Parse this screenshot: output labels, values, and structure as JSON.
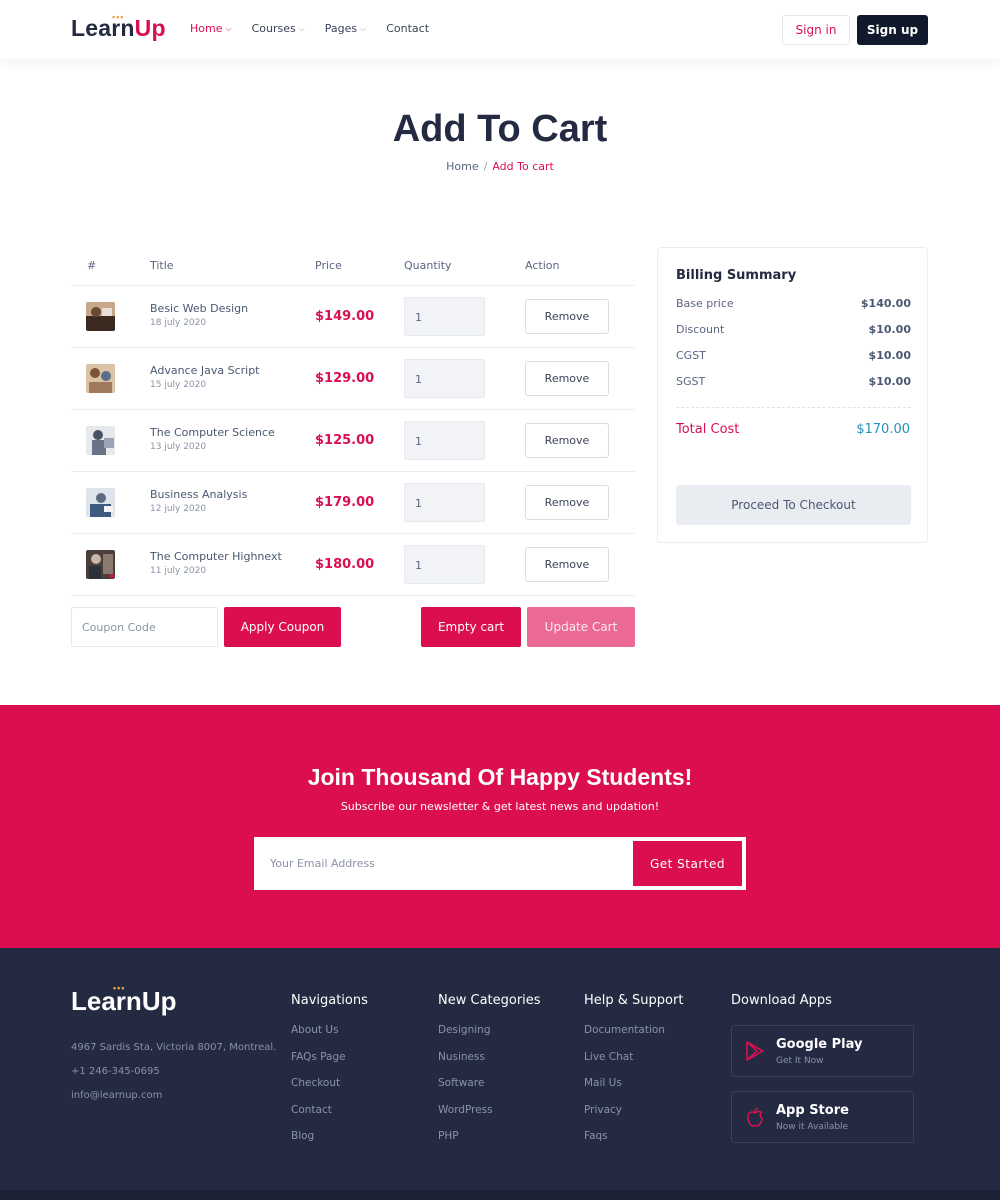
{
  "header": {
    "logo_learn": "Learn",
    "logo_up": "Up",
    "nav": [
      {
        "label": "Home",
        "active": true
      },
      {
        "label": "Courses",
        "active": false
      },
      {
        "label": "Pages",
        "active": false
      },
      {
        "label": "Contact",
        "active": false
      }
    ],
    "signin_label": "Sign in",
    "signup_label": "Sign up"
  },
  "page": {
    "title": "Add To Cart",
    "breadcrumb": {
      "home": "Home",
      "separator": "/",
      "current": "Add To cart"
    }
  },
  "cart": {
    "columns": {
      "index": "#",
      "title": "Title",
      "price": "Price",
      "quantity": "Quantity",
      "action": "Action"
    },
    "items": [
      {
        "title": "Besic Web Design",
        "date": "18 july 2020",
        "price": "$149.00",
        "quantity": "1",
        "action": "Remove"
      },
      {
        "title": "Advance Java Script",
        "date": "15 july 2020",
        "price": "$129.00",
        "quantity": "1",
        "action": "Remove"
      },
      {
        "title": "The Computer Science",
        "date": "13 july 2020",
        "price": "$125.00",
        "quantity": "1",
        "action": "Remove"
      },
      {
        "title": "Business Analysis",
        "date": "12 july 2020",
        "price": "$179.00",
        "quantity": "1",
        "action": "Remove"
      },
      {
        "title": "The Computer Highnext",
        "date": "11 july 2020",
        "price": "$180.00",
        "quantity": "1",
        "action": "Remove"
      }
    ],
    "coupon_placeholder": "Coupon Code",
    "apply_coupon_label": "Apply Coupon",
    "empty_cart_label": "Empty cart",
    "update_cart_label": "Update Cart"
  },
  "billing": {
    "title": "Billing Summary",
    "rows": [
      {
        "label": "Base price",
        "value": "$140.00"
      },
      {
        "label": "Discount",
        "value": "$10.00"
      },
      {
        "label": "CGST",
        "value": "$10.00"
      },
      {
        "label": "SGST",
        "value": "$10.00"
      }
    ],
    "total_label": "Total Cost",
    "total_value": "$170.00",
    "checkout_label": "Proceed To Checkout"
  },
  "newsletter": {
    "title": "Join Thousand Of Happy Students!",
    "subtitle": "Subscribe our newsletter & get latest news and updation!",
    "email_placeholder": "Your Email Address",
    "button_label": "Get Started"
  },
  "footer": {
    "logo_learn": "Learn",
    "logo_up": "Up",
    "address": "4967 Sardis Sta, Victoria 8007, Montreal.",
    "phone": "+1 246-345-0695",
    "email": "info@learnup.com",
    "columns": [
      {
        "heading": "Navigations",
        "links": [
          "About Us",
          "FAQs Page",
          "Checkout",
          "Contact",
          "Blog"
        ]
      },
      {
        "heading": "New Categories",
        "links": [
          "Designing",
          "Nusiness",
          "Software",
          "WordPress",
          "PHP"
        ]
      },
      {
        "heading": "Help & Support",
        "links": [
          "Documentation",
          "Live Chat",
          "Mail Us",
          "Privacy",
          "Faqs"
        ]
      }
    ],
    "download_heading": "Download Apps",
    "stores": [
      {
        "name": "Google Play",
        "sub": "Get It Now",
        "icon": "google-play-icon"
      },
      {
        "name": "App Store",
        "sub": "Now it Available",
        "icon": "apple-icon"
      }
    ]
  },
  "colors": {
    "accent": "#db0f4f",
    "dark": "#242a41",
    "footer_bg": "#232a41",
    "total_value": "#2a8fc1"
  }
}
